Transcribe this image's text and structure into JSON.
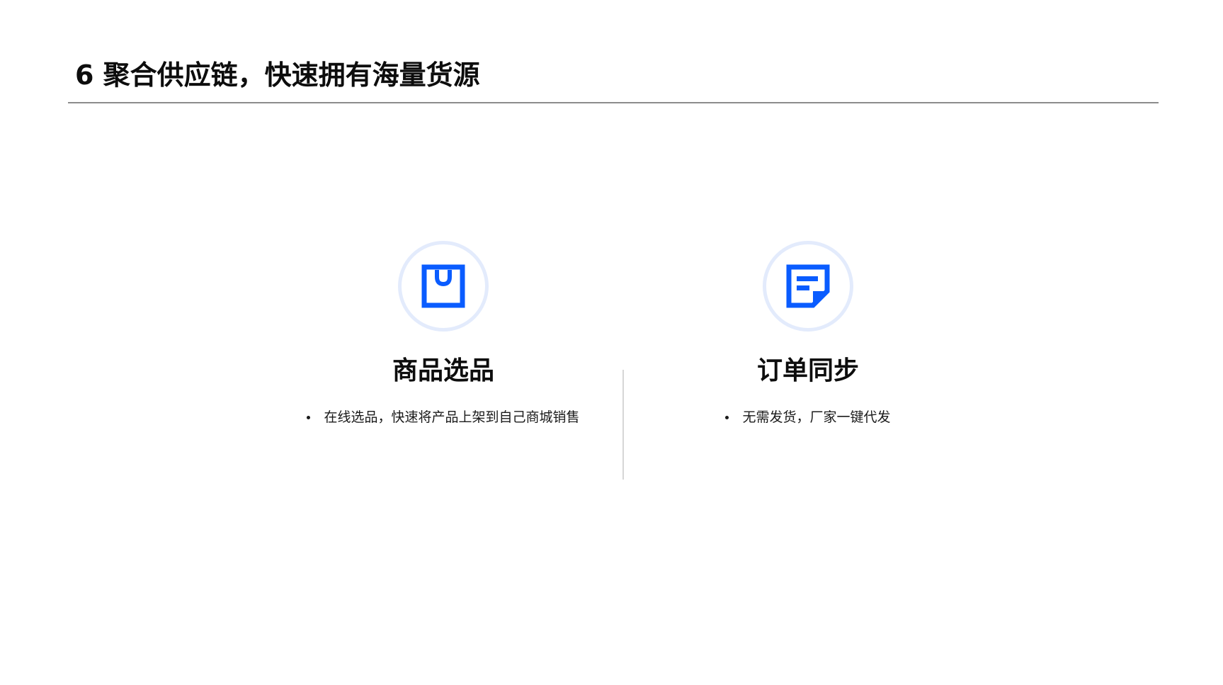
{
  "page": {
    "title": "6 聚合供应链，快速拥有海量货源"
  },
  "features": [
    {
      "icon": "shopping-bag-icon",
      "title": "商品选品",
      "bullets": [
        "在线选品，快速将产品上架到自己商城销售"
      ]
    },
    {
      "icon": "document-icon",
      "title": "订单同步",
      "bullets": [
        "无需发货，厂家一键代发"
      ]
    }
  ],
  "colors": {
    "accent": "#0a5cff",
    "icon_ring": "#e3ebfc",
    "rule": "#8c8c8c",
    "divider": "#d6d6d6",
    "text": "#0d0d0d"
  }
}
